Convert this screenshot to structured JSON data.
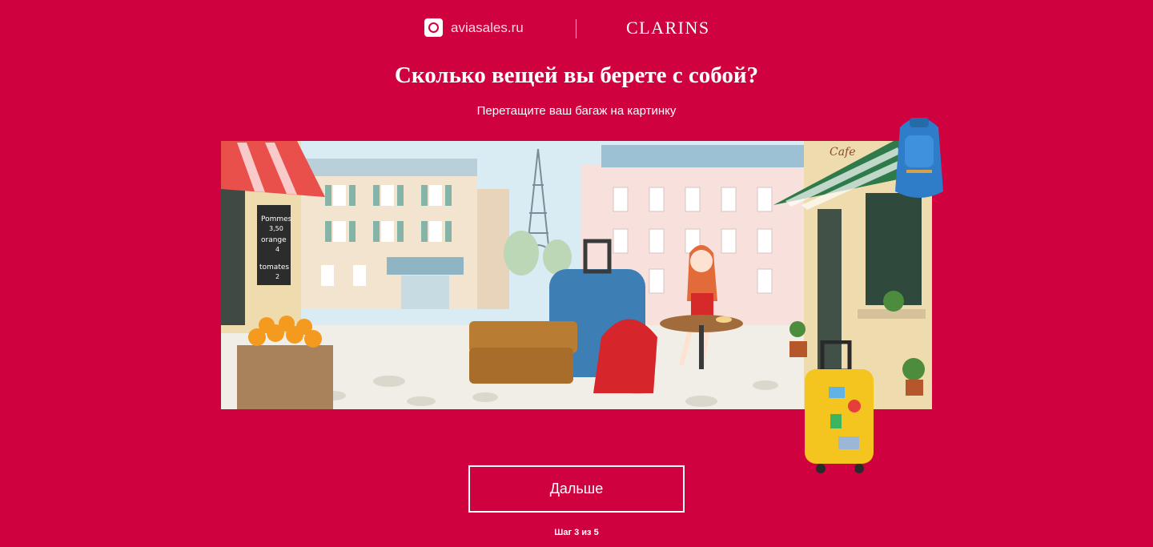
{
  "header": {
    "avia_logo_text": "aviasales.ru",
    "clarins_logo_text": "CLARINS"
  },
  "main": {
    "title": "Сколько вещей вы берете с собой?",
    "subtitle": "Перетащите ваш багаж на картинку",
    "scene": {
      "chalkboard_lines": [
        "Pommes",
        "3,50",
        "orange",
        "4",
        "tomates",
        "2"
      ],
      "cafe_sign": "Cafe"
    },
    "draggable_items": [
      {
        "name": "blue-backpack",
        "color": "#2f7cc9"
      },
      {
        "name": "yellow-suitcase",
        "color": "#f4c51e"
      }
    ],
    "next_button_label": "Дальше",
    "step_text": "Шаг 3 из 5"
  },
  "colors": {
    "background": "#d0013f",
    "text": "#ffffff"
  }
}
